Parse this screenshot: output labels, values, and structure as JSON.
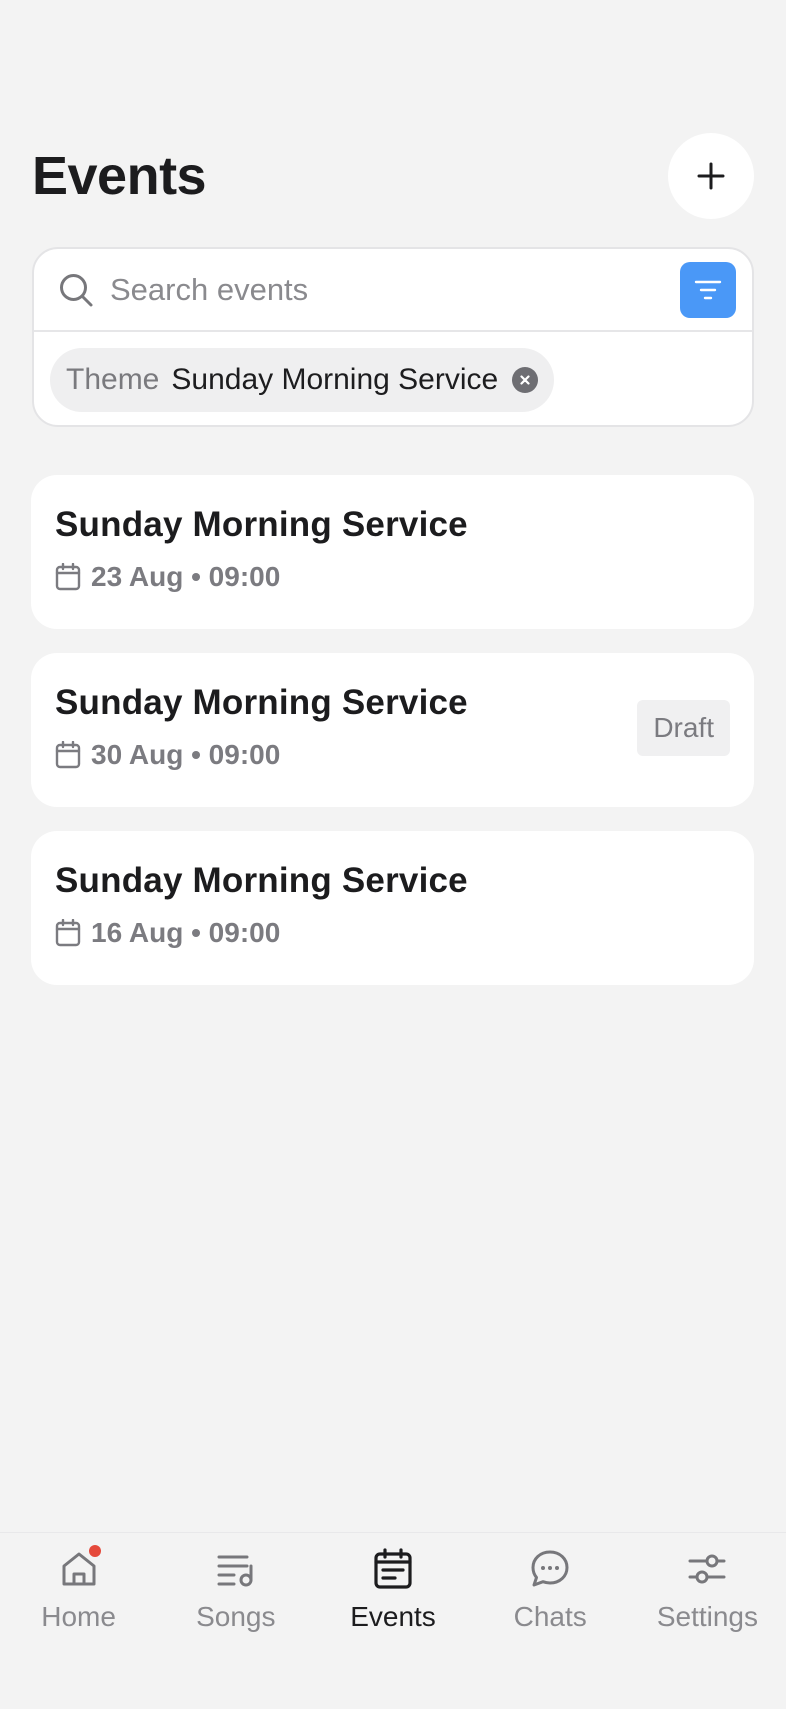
{
  "header": {
    "title": "Events",
    "add_icon": "plus-icon"
  },
  "search": {
    "placeholder": "Search events",
    "value": "",
    "search_icon": "search-icon",
    "filter_icon": "filter-icon",
    "filter_color": "#4a98f7"
  },
  "active_filter": {
    "key": "Theme",
    "value": "Sunday Morning Service",
    "clear_icon": "close-circle-icon"
  },
  "events": [
    {
      "title": "Sunday Morning Service",
      "date": "23 Aug • 09:00",
      "badge": ""
    },
    {
      "title": "Sunday Morning Service",
      "date": "30 Aug • 09:00",
      "badge": "Draft"
    },
    {
      "title": "Sunday Morning Service",
      "date": "16 Aug • 09:00",
      "badge": ""
    }
  ],
  "nav": {
    "items": [
      {
        "label": "Home",
        "icon": "home-icon",
        "active": false,
        "notification": true
      },
      {
        "label": "Songs",
        "icon": "music-list-icon",
        "active": false
      },
      {
        "label": "Events",
        "icon": "calendar-icon",
        "active": true
      },
      {
        "label": "Chats",
        "icon": "chat-bubble-icon",
        "active": false
      },
      {
        "label": "Settings",
        "icon": "sliders-icon",
        "active": false
      }
    ],
    "notification_color": "#e5493b"
  }
}
